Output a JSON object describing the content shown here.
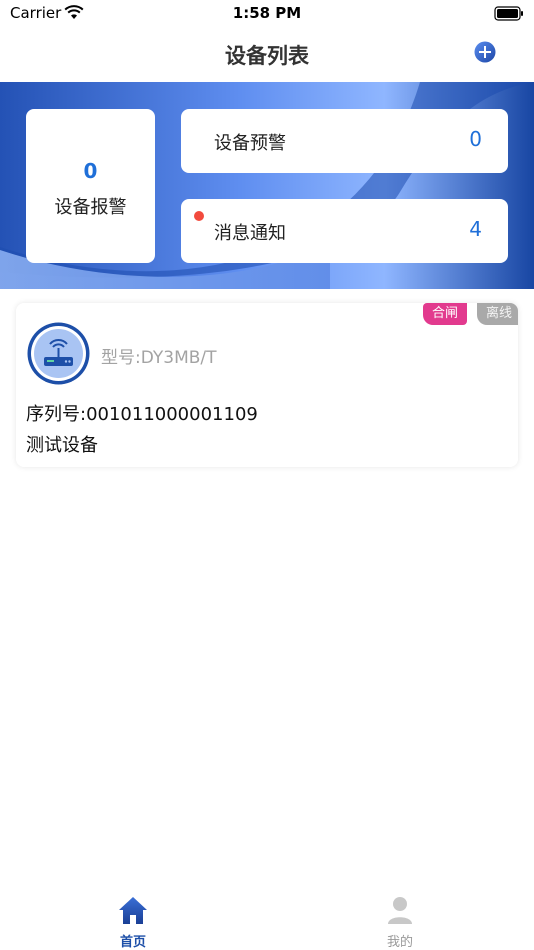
{
  "status_bar": {
    "carrier": "Carrier",
    "time": "1:58 PM"
  },
  "nav": {
    "title": "设备列表",
    "add_icon": "plus-circle-icon"
  },
  "summary": {
    "alarm": {
      "count": "0",
      "label": "设备报警"
    },
    "warning": {
      "label": "设备预警",
      "count": "0"
    },
    "notice": {
      "label": "消息通知",
      "count": "4",
      "has_unread": true
    }
  },
  "devices": [
    {
      "switch_tag": "合闸",
      "status_tag": "离线",
      "model": "型号:DY3MB/T",
      "serial": "序列号:001011000001109",
      "name": "测试设备",
      "icon": "router-icon"
    }
  ],
  "tab_bar": {
    "home": {
      "label": "首页",
      "icon": "home-icon",
      "active": true
    },
    "mine": {
      "label": "我的",
      "icon": "user-icon",
      "active": false
    }
  },
  "colors": {
    "accent": "#1f6fd8",
    "banner_dark": "#1846a3",
    "banner_light": "#8fb6ff",
    "tag_switch": "#e23a8e",
    "tag_offline": "#a9a9a9",
    "unread_dot": "#f24a3d"
  }
}
